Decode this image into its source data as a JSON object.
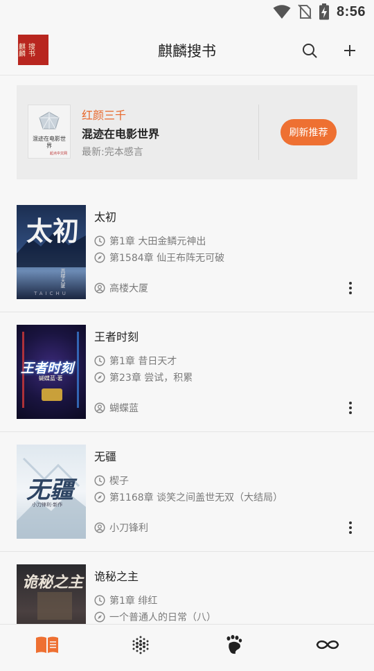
{
  "status_bar": {
    "time": "8:56"
  },
  "app_bar": {
    "title": "麒麟搜书",
    "logo_text": "麒麟搜书",
    "search_icon": "search-icon",
    "add_icon": "plus-icon"
  },
  "recommendation": {
    "author": "红颜三千",
    "title": "混迹在电影世界",
    "latest": "最新:完本感言",
    "cover_title": "混迹在电影世界",
    "cover_publisher": "起点中文网",
    "button_label": "刷新推荐"
  },
  "books": [
    {
      "title": "太初",
      "read_chapter": "第1章 大田金鳞元神出",
      "latest_chapter": "第1584章 仙王布阵无可破",
      "author": "高楼大厦",
      "cover_text": "太初",
      "cover_sub": "TAICHU",
      "cover_author": "高楼大厦"
    },
    {
      "title": "王者时刻",
      "read_chapter": "第1章 昔日天才",
      "latest_chapter": "第23章 尝试，积累",
      "author": "蝴蝶蓝",
      "cover_text": "王者时刻",
      "cover_author": "蝴蝶蓝·著"
    },
    {
      "title": "无疆",
      "read_chapter": "楔子",
      "latest_chapter": "第1168章 谈笑之间盖世无双（大结局）",
      "author": "小刀锋利",
      "cover_text": "无疆",
      "cover_author": "小刀锋利·新作"
    },
    {
      "title": "诡秘之主",
      "read_chapter": "第1章 绯红",
      "latest_chapter": "一个普通人的日常（八）",
      "author": "",
      "cover_text": "诡秘之主"
    }
  ],
  "bottom_nav": [
    {
      "icon": "bookshelf-icon",
      "active": true
    },
    {
      "icon": "discover-dots-icon",
      "active": false
    },
    {
      "icon": "footprint-icon",
      "active": false
    },
    {
      "icon": "infinity-icon",
      "active": false
    }
  ],
  "colors": {
    "accent": "#ee7032",
    "author_orange": "#e8672a",
    "logo_red": "#b8261f"
  }
}
